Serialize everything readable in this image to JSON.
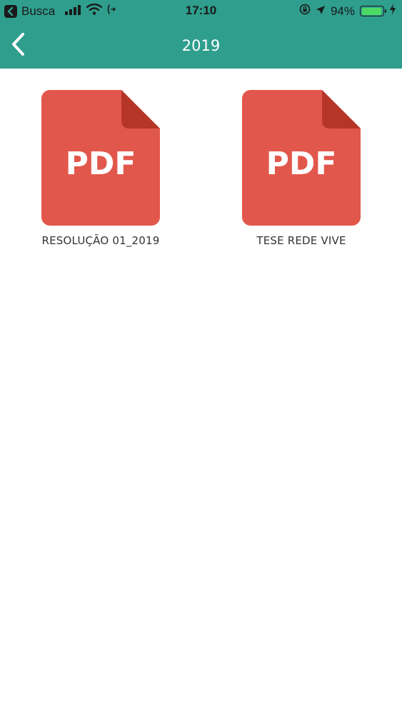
{
  "status_bar": {
    "back_app_label": "Busca",
    "time": "17:10",
    "battery_percent": "94%",
    "battery_level": 0.94,
    "signal_icon": "cellular-signal-icon",
    "wifi_icon": "wifi-icon",
    "lock_icon": "rotation-lock-icon",
    "location_icon": "location-arrow-icon",
    "charging_icon": "charging-bolt-icon"
  },
  "nav": {
    "title": "2019",
    "back_icon": "chevron-left-icon"
  },
  "colors": {
    "header": "#2f9e8d",
    "pdf_body": "#e2574c",
    "pdf_fold": "#b53629",
    "battery_fill": "#4cd964"
  },
  "files": [
    {
      "label": "RESOLUÇÃO 01_2019",
      "icon_text": "PDF"
    },
    {
      "label": "TESE REDE VIVE",
      "icon_text": "PDF"
    }
  ]
}
